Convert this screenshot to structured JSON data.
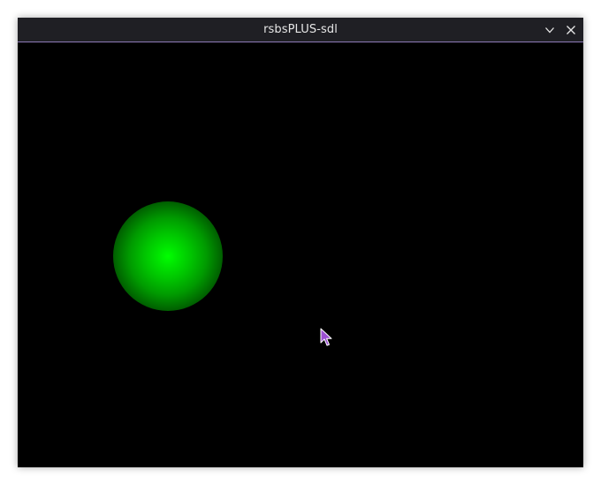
{
  "window": {
    "title": "rsbsPLUS-sdl"
  },
  "titlebar": {
    "buttons": [
      {
        "icon": "chevron-down-icon"
      },
      {
        "icon": "close-icon"
      }
    ]
  },
  "colors": {
    "titlebar_bg": "#1f1f24",
    "titlebar_accent": "#8e7bb8",
    "canvas_bg": "#000000",
    "orb": "#00ff00",
    "cursor": "#9b4fd1"
  },
  "canvas": {
    "objects": [
      {
        "type": "green-orb"
      },
      {
        "type": "mouse-cursor"
      }
    ]
  }
}
